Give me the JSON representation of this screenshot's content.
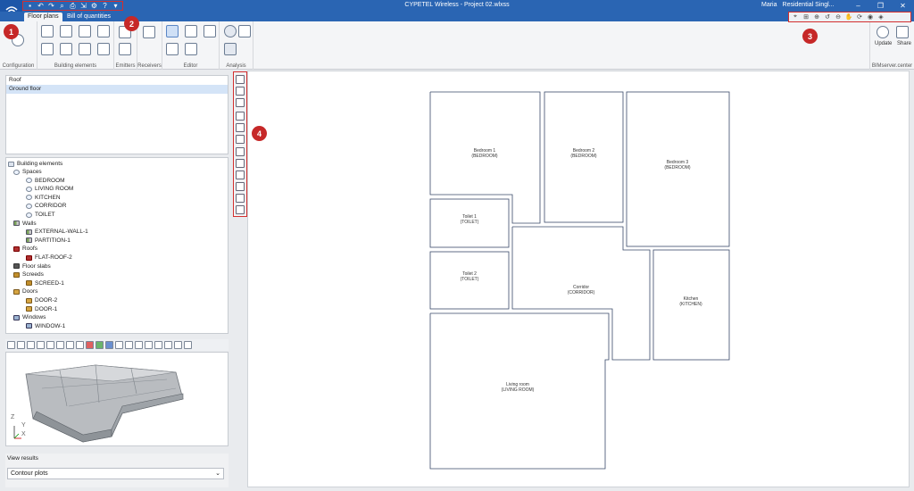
{
  "window": {
    "title": "CYPETEL Wireless - Project 02.wlxss",
    "user": "Maria",
    "project_selector": "Residential Singl..."
  },
  "tabs": [
    {
      "label": "Floor plans",
      "active": true
    },
    {
      "label": "Bill of quantities",
      "active": false
    }
  ],
  "ribbon": {
    "groups": [
      "Configuration",
      "Building elements",
      "Emitters",
      "Receivers",
      "Editor",
      "Analysis",
      "BIMserver.center"
    ],
    "update_label": "Update",
    "share_label": "Share"
  },
  "floors": [
    "Roof",
    "Ground floor"
  ],
  "floors_selected": "Ground floor",
  "tree": {
    "root": "Building elements",
    "items": [
      {
        "label": "Spaces",
        "level": 1,
        "icon": "space"
      },
      {
        "label": "BEDROOM",
        "level": 2,
        "icon": "space"
      },
      {
        "label": "LIVING ROOM",
        "level": 2,
        "icon": "space"
      },
      {
        "label": "KITCHEN",
        "level": 2,
        "icon": "space"
      },
      {
        "label": "CORRIDOR",
        "level": 2,
        "icon": "space"
      },
      {
        "label": "TOILET",
        "level": 2,
        "icon": "space"
      },
      {
        "label": "Walls",
        "level": 1,
        "icon": "wall"
      },
      {
        "label": "EXTERNAL-WALL-1",
        "level": 2,
        "icon": "wall"
      },
      {
        "label": "PARTITION-1",
        "level": 2,
        "icon": "wall"
      },
      {
        "label": "Roofs",
        "level": 1,
        "icon": "roof"
      },
      {
        "label": "FLAT-ROOF-2",
        "level": 2,
        "icon": "roof"
      },
      {
        "label": "Floor slabs",
        "level": 1,
        "icon": "slab"
      },
      {
        "label": "Screeds",
        "level": 1,
        "icon": "screed"
      },
      {
        "label": "SCREED-1",
        "level": 2,
        "icon": "screed"
      },
      {
        "label": "Doors",
        "level": 1,
        "icon": "door"
      },
      {
        "label": "DOOR-2",
        "level": 2,
        "icon": "door"
      },
      {
        "label": "DOOR-1",
        "level": 2,
        "icon": "door"
      },
      {
        "label": "Windows",
        "level": 1,
        "icon": "win"
      },
      {
        "label": "WINDOW-1",
        "level": 2,
        "icon": "win"
      }
    ]
  },
  "view_results": {
    "label": "View results",
    "value": "Contour plots"
  },
  "rooms": [
    {
      "name": "Bedroom 1",
      "type": "(BEDROOM)"
    },
    {
      "name": "Bedroom 2",
      "type": "(BEDROOM)"
    },
    {
      "name": "Bedroom 3",
      "type": "(BEDROOM)"
    },
    {
      "name": "Toilet 1",
      "type": "(TOILET)"
    },
    {
      "name": "Toilet 2",
      "type": "(TOILET)"
    },
    {
      "name": "Corridor",
      "type": "(CORRIDOR)"
    },
    {
      "name": "Kitchen",
      "type": "(KITCHEN)"
    },
    {
      "name": "Living room",
      "type": "(LIVING ROOM)"
    }
  ],
  "callouts": [
    "1",
    "2",
    "3",
    "4"
  ],
  "triad_axes": {
    "x": "X",
    "y": "Y",
    "z": "Z"
  },
  "colors": {
    "titlebar": "#2a65b3",
    "highlight": "#d32f2f",
    "badge": "#c62828"
  }
}
